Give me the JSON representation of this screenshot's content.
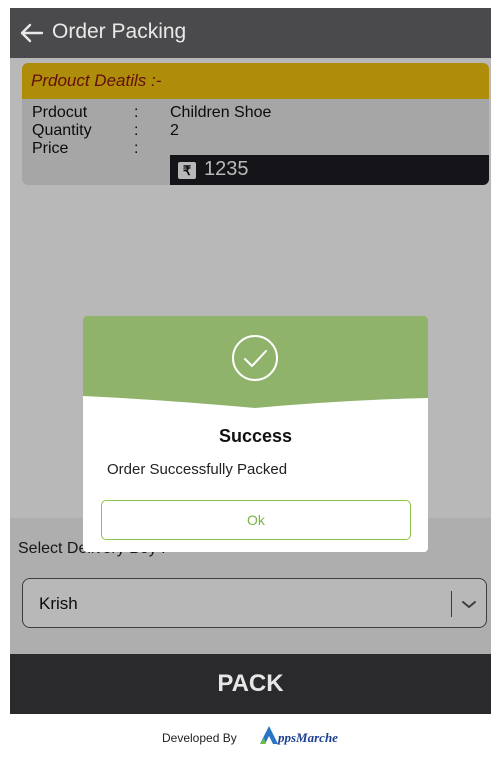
{
  "header": {
    "title": "Order Packing"
  },
  "product_details": {
    "heading": "Prdouct Deatils :-",
    "rows": [
      {
        "label": "Prdocut",
        "separator": ":",
        "value": "Children Shoe"
      },
      {
        "label": "Quantity",
        "separator": ":",
        "value": "2"
      },
      {
        "label": "Price",
        "separator": ":",
        "value": "1235"
      }
    ],
    "currency_symbol": "₹"
  },
  "dialog": {
    "title": "Success",
    "message": "Order Successfully Packed",
    "ok_label": "Ok",
    "icon": "check-circle-icon",
    "accent_color": "#8fb36a"
  },
  "delivery": {
    "label": "Select Delivery Boy :",
    "selected": "Krish",
    "arrow_icon": "chevron-down-icon"
  },
  "actions": {
    "pack_label": "PACK"
  },
  "footer": {
    "developed_by": "Developed By",
    "brand_name": "ppsMarche",
    "brand_mark_letter": "A"
  },
  "colors": {
    "header_bg": "#4a4a4c",
    "details_heading_bg": "#f1c40f",
    "details_heading_text": "#8a1410",
    "pack_bar_bg": "#2a2a2d",
    "dialog_top": "#8fb36a"
  }
}
